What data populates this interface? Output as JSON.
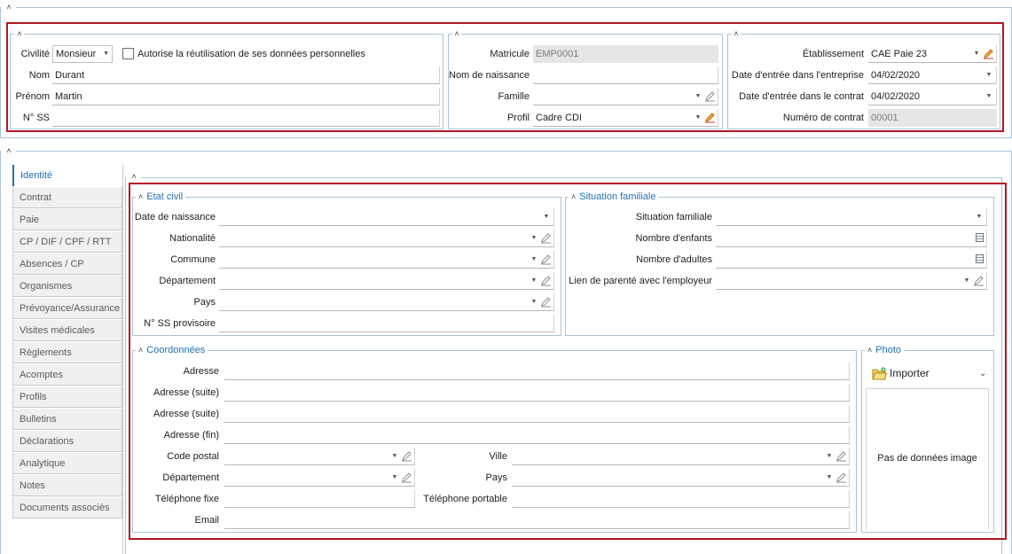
{
  "header": {
    "civilite": {
      "label": "Civilité",
      "value": "Monsieur"
    },
    "consent": {
      "label": "Autorise la réutilisation de ses données personnelles",
      "checked": false
    },
    "nom": {
      "label": "Nom",
      "value": "Durant"
    },
    "prenom": {
      "label": "Prénom",
      "value": "Martin"
    },
    "nss": {
      "label": "N° SS",
      "value": ""
    },
    "matricule": {
      "label": "Matricule",
      "value": "EMP0001"
    },
    "nom_naissance": {
      "label": "Nom de naissance",
      "value": ""
    },
    "famille": {
      "label": "Famille",
      "value": ""
    },
    "profil": {
      "label": "Profil",
      "value": "Cadre CDI"
    },
    "etablissement": {
      "label": "Établissement",
      "value": "CAE Paie 23"
    },
    "date_entree_entreprise": {
      "label": "Date d'entrée dans l'entreprise",
      "value": "04/02/2020"
    },
    "date_entree_contrat": {
      "label": "Date d'entrée dans le contrat",
      "value": "04/02/2020"
    },
    "numero_contrat": {
      "label": "Numéro de contrat",
      "value": "00001"
    }
  },
  "tabs": [
    {
      "label": "Identité",
      "active": true
    },
    {
      "label": "Contrat"
    },
    {
      "label": "Paie"
    },
    {
      "label": "CP / DIF / CPF / RTT"
    },
    {
      "label": "Absences / CP"
    },
    {
      "label": "Organismes"
    },
    {
      "label": "Prévoyance/Assurance"
    },
    {
      "label": "Visites médicales"
    },
    {
      "label": "Règlements"
    },
    {
      "label": "Acomptes"
    },
    {
      "label": "Profils"
    },
    {
      "label": "Bulletins"
    },
    {
      "label": "Déclarations"
    },
    {
      "label": "Analytique"
    },
    {
      "label": "Notes"
    },
    {
      "label": "Documents associés"
    }
  ],
  "etat_civil": {
    "title": "Etat civil",
    "date_naissance": {
      "label": "Date de naissance",
      "value": ""
    },
    "nationalite": {
      "label": "Nationalité",
      "value": ""
    },
    "commune": {
      "label": "Commune",
      "value": ""
    },
    "departement": {
      "label": "Département",
      "value": ""
    },
    "pays": {
      "label": "Pays",
      "value": ""
    },
    "nss_provisoire": {
      "label": "N° SS provisoire",
      "value": ""
    }
  },
  "situation_familiale": {
    "title": "Situation familiale",
    "situation": {
      "label": "Situation familiale",
      "value": ""
    },
    "nb_enfants": {
      "label": "Nombre d'enfants",
      "value": ""
    },
    "nb_adultes": {
      "label": "Nombre d'adultes",
      "value": ""
    },
    "lien_parente": {
      "label": "Lien de parenté avec l'employeur",
      "value": ""
    }
  },
  "coordonnees": {
    "title": "Coordonnées",
    "adresse": {
      "label": "Adresse",
      "value": ""
    },
    "adresse_suite1": {
      "label": "Adresse (suite)",
      "value": ""
    },
    "adresse_suite2": {
      "label": "Adresse (suite)",
      "value": ""
    },
    "adresse_fin": {
      "label": "Adresse (fin)",
      "value": ""
    },
    "code_postal": {
      "label": "Code postal",
      "value": ""
    },
    "ville": {
      "label": "Ville",
      "value": ""
    },
    "departement": {
      "label": "Département",
      "value": ""
    },
    "pays": {
      "label": "Pays",
      "value": ""
    },
    "tel_fixe": {
      "label": "Téléphone fixe",
      "value": ""
    },
    "tel_portable": {
      "label": "Téléphone portable",
      "value": ""
    },
    "email": {
      "label": "Email",
      "value": ""
    }
  },
  "photo": {
    "title": "Photo",
    "import_label": "Importer",
    "empty_text": "Pas de données image"
  },
  "icons": {
    "collapse": "chevron-up-icon",
    "dropdown": "dropdown-arrow-icon",
    "edit": "pencil-icon",
    "calculator": "calculator-icon",
    "folder": "folder-import-icon"
  },
  "colors": {
    "accent": "#1f6fb5",
    "highlight_border": "#b01822",
    "readonly_bg": "#e6e6e6",
    "group_border": "#a9c4d9"
  }
}
